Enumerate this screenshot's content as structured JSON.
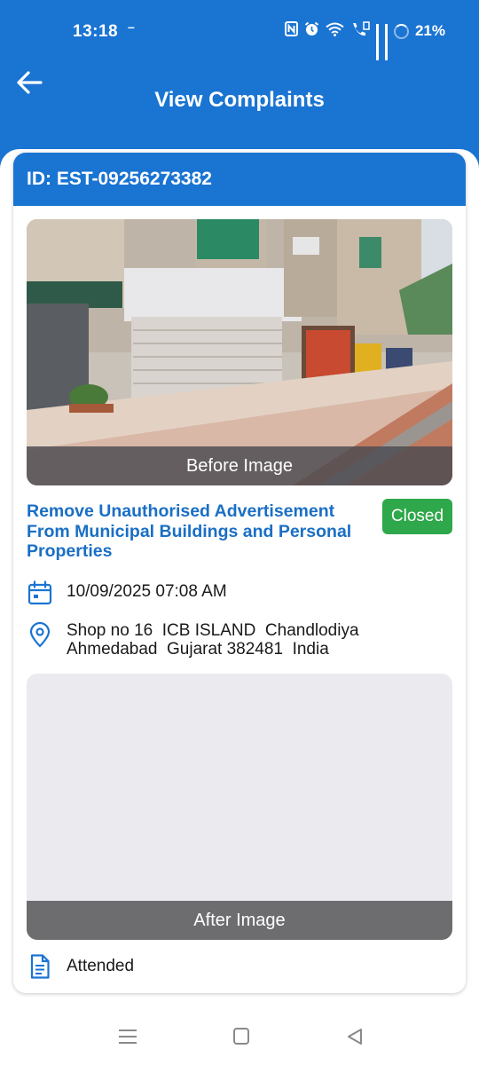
{
  "status_bar": {
    "time": "13:18",
    "network_indicator": "–",
    "battery": "21%",
    "icons": [
      "nfc-icon",
      "alarm-icon",
      "wifi-icon",
      "volte-call-icon",
      "signal-icon",
      "signal-icon",
      "battery-ring-icon"
    ]
  },
  "header": {
    "title": "View Complaints",
    "back_icon": "arrow-left-icon"
  },
  "complaint": {
    "id_label": "ID: EST-09256273382",
    "before_image_label": "Before Image",
    "title": "Remove Unauthorised Advertisement From Municipal Buildings and Personal Properties",
    "status": "Closed",
    "datetime": "10/09/2025 07:08 AM",
    "address": "Shop no 16  ICB ISLAND  Chandlodiya\nAhmedabad  Gujarat 382481  India",
    "after_image_label": "After Image",
    "progress_status": "Attended"
  },
  "colors": {
    "primary": "#1a74d2",
    "title_blue": "#1a6fc4",
    "status_green": "#2ea84a"
  },
  "nav": {
    "items": [
      "menu-icon",
      "home-icon",
      "back-icon"
    ]
  }
}
